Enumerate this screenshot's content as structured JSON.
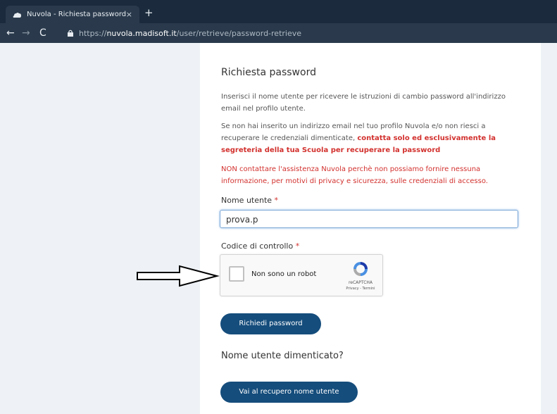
{
  "browser": {
    "tab_title": "Nuvola - Richiesta password",
    "tab_close": "×",
    "new_tab": "+",
    "back": "←",
    "forward": "→",
    "reload": "C",
    "url_prefix": "https://",
    "url_host": "nuvola.madisoft.it",
    "url_path": "/user/retrieve/password-retrieve"
  },
  "page": {
    "title": "Richiesta password",
    "intro": "Inserisci il nome utente per ricevere le istruzioni di cambio password all'indirizzo email nel profilo utente.",
    "notice_part1": "Se non hai inserito un indirizzo email nel tuo profilo Nuvola e/o non riesci a recuperare le credenziali dimenticate, ",
    "notice_part2": "contatta solo ed esclusivamente la segreteria della tua Scuola per recuperare la password",
    "warning": "NON contattare l'assistenza Nuvola perchè non possiamo fornire nessuna informazione, per motivi di privacy e sicurezza, sulle credenziali di accesso.",
    "username_label": "Nome utente",
    "required_star": "*",
    "username_value": "prova.p",
    "captcha_label": "Codice di controllo",
    "captcha_text": "Non sono un robot",
    "captcha_brand": "reCAPTCHA",
    "captcha_terms": "Privacy - Termini",
    "submit_label": "Richiedi password",
    "forgot_title": "Nome utente dimenticato?",
    "forgot_button": "Vai al recupero nome utente"
  },
  "colors": {
    "accent": "#154d7c",
    "warning": "#d2312e",
    "page_background": "#eef2f6"
  }
}
